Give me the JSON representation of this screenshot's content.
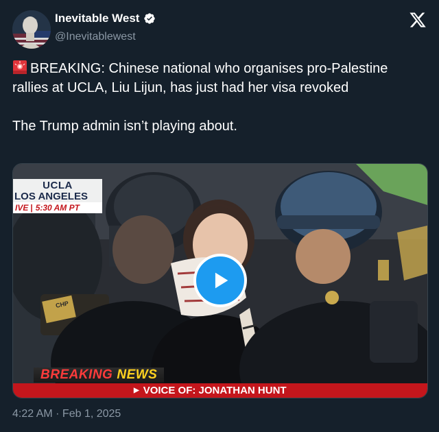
{
  "author": {
    "name": "Inevitable West",
    "handle": "@Inevitablewest",
    "verified": true
  },
  "icons": {
    "avatar": "avatar-statue-flag",
    "verified": "verified-badge-icon",
    "platform": "x-logo-icon",
    "siren": "siren-emoji-icon",
    "play": "play-icon"
  },
  "tweet": {
    "text_line1": "BREAKING: Chinese national who organises pro-Palestine rallies at UCLA, Liu Lijun, has just had her visa revoked",
    "text_line2": "The Trump admin isn’t playing about."
  },
  "video": {
    "overlay_location_1": "UCLA",
    "overlay_location_2": "LOS ANGELES",
    "live_tag": "IVE",
    "live_time": "5:30 AM PT",
    "badge_text": "CHP",
    "breaking_word1": "BREAKING",
    "breaking_word2": "NEWS",
    "voice_of": "VOICE OF: JONATHAN HUNT"
  },
  "timestamp": "4:22 AM · Feb 1, 2025",
  "colors": {
    "background": "#15202b",
    "accent": "#1d9bf0",
    "secondary_text": "#8b98a5",
    "news_red": "#c4161c"
  }
}
